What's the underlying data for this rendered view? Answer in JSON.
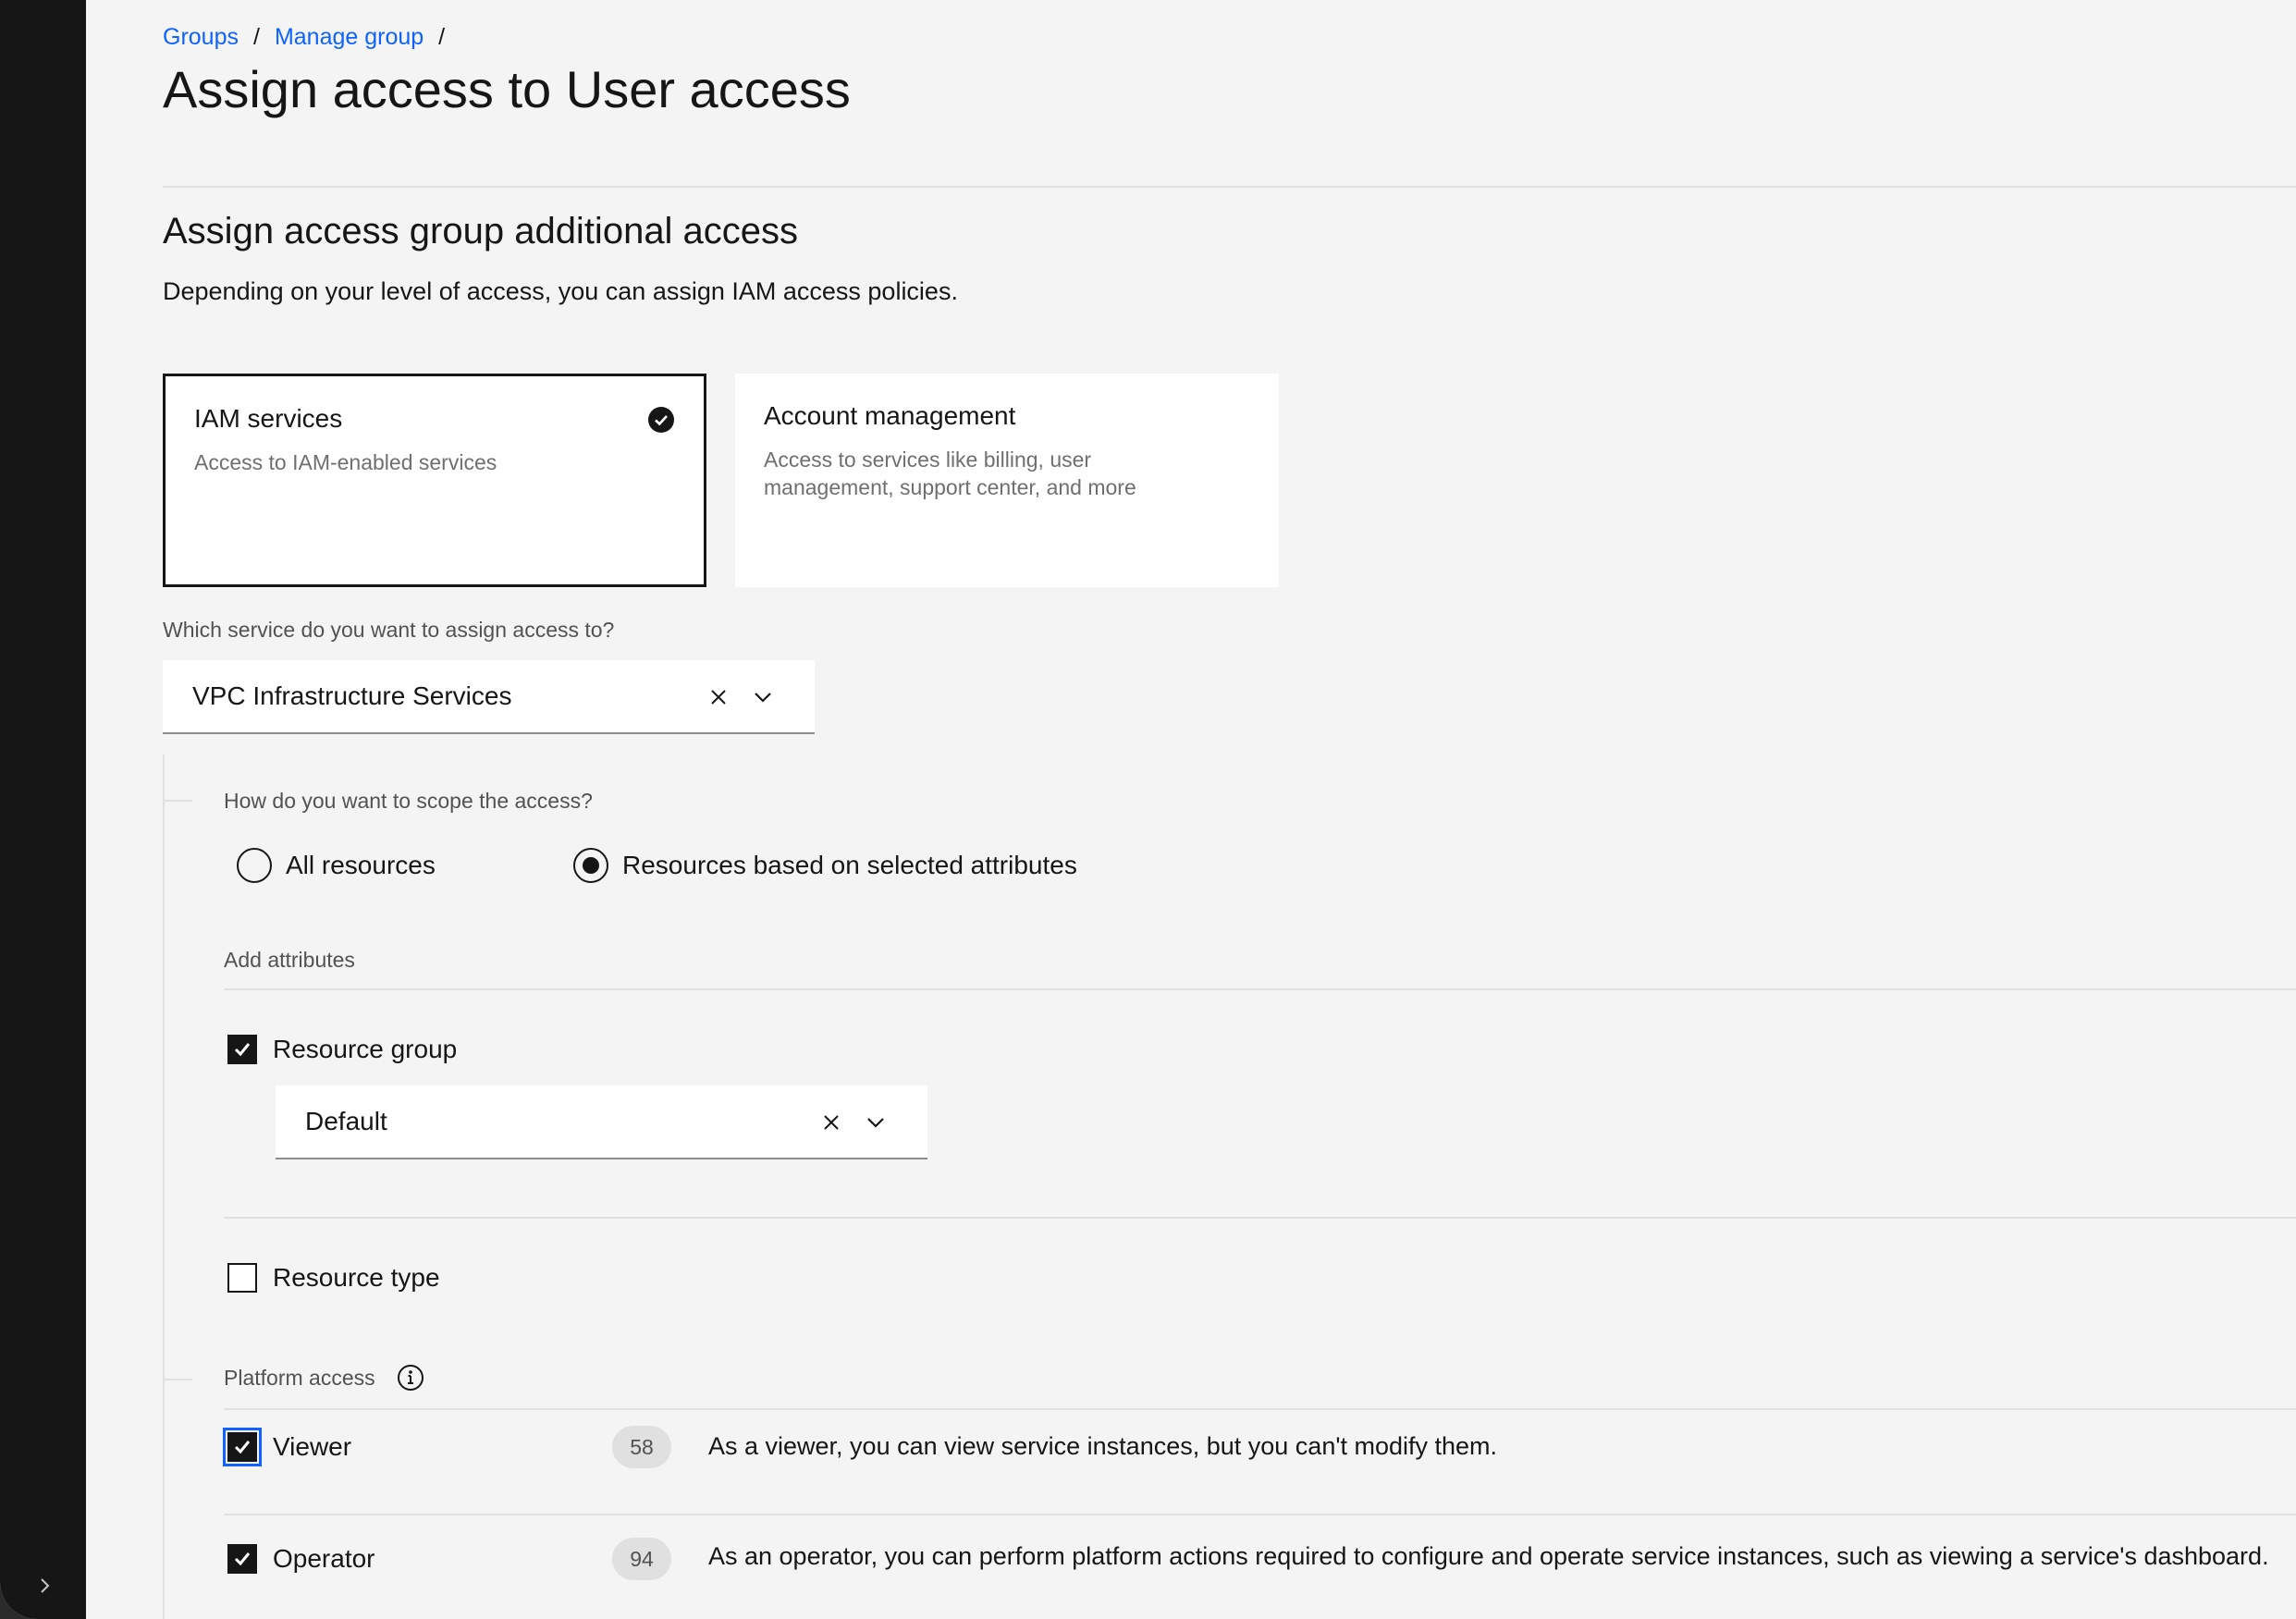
{
  "breadcrumb": {
    "groups": "Groups",
    "manage_group": "Manage group",
    "separator": "/"
  },
  "page_title": "Assign access to User access",
  "section": {
    "title": "Assign access group additional access",
    "description": "Depending on your level of access, you can assign IAM access policies."
  },
  "tiles": {
    "iam": {
      "title": "IAM services",
      "description": "Access to IAM-enabled services",
      "selected": true
    },
    "account": {
      "title": "Account management",
      "description_line1": "Access to services like billing, user",
      "description_line2": "management, support center, and more"
    }
  },
  "service_field": {
    "label": "Which service do you want to assign access to?",
    "value": "VPC Infrastructure Services"
  },
  "scope": {
    "label": "How do you want to scope the access?",
    "options": [
      {
        "label": "All resources",
        "selected": false
      },
      {
        "label": "Resources based on selected attributes",
        "selected": true
      }
    ]
  },
  "attributes": {
    "label": "Add attributes",
    "resource_group": {
      "label": "Resource group",
      "checked": true,
      "value": "Default"
    },
    "resource_type": {
      "label": "Resource type",
      "checked": false
    }
  },
  "platform_access": {
    "label": "Platform access",
    "roles": [
      {
        "name": "Viewer",
        "count": "58",
        "description": "As a viewer, you can view service instances, but you can't modify them.",
        "checked": true
      },
      {
        "name": "Operator",
        "count": "94",
        "description": "As an operator, you can perform platform actions required to configure and operate service instances, such as viewing a service's dashboard.",
        "checked": true
      }
    ]
  },
  "colors": {
    "accent": "#0f62fe",
    "rail": "#161616",
    "background": "#f4f4f4"
  }
}
